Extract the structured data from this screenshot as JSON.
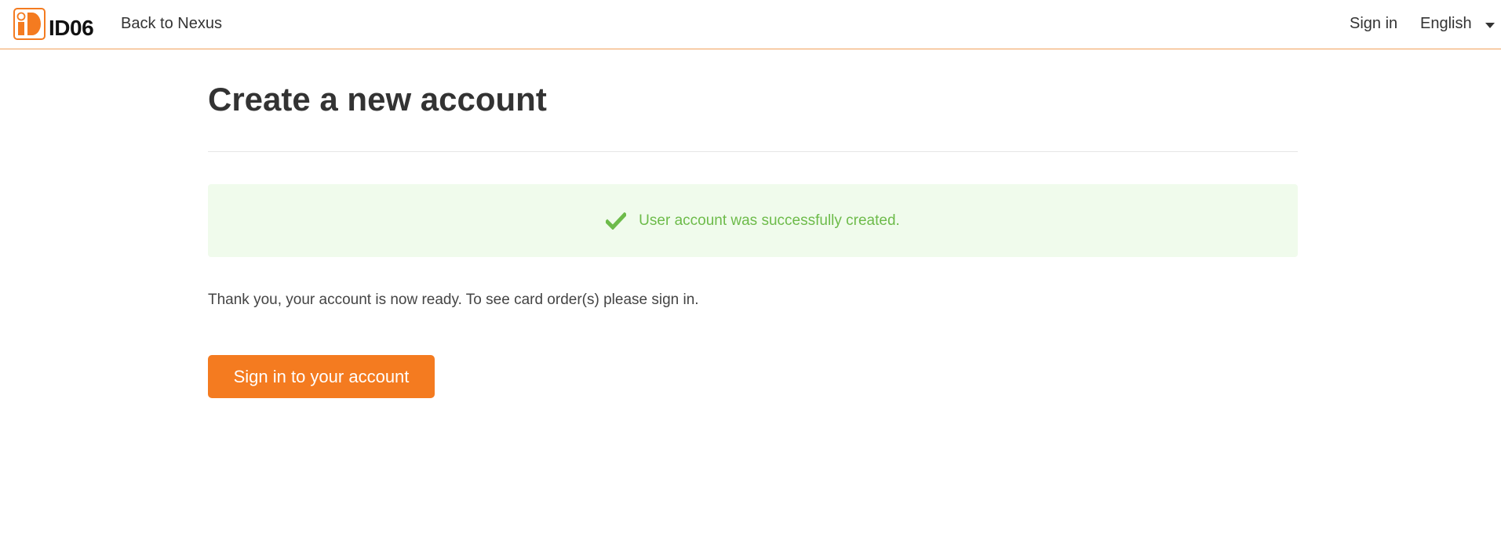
{
  "header": {
    "logo_text": "ID06",
    "back_link": "Back to Nexus",
    "signin_link": "Sign in",
    "language": "English"
  },
  "main": {
    "title": "Create a new account",
    "alert": {
      "message": "User account was successfully created.",
      "icon": "checkmark-icon"
    },
    "body_text": "Thank you, your account is now ready. To see card order(s) please sign in.",
    "button_label": "Sign in to your account"
  },
  "colors": {
    "accent": "#f47b20",
    "success_bg": "#f0fbec",
    "success_text": "#6dbb4a",
    "text": "#333333"
  }
}
